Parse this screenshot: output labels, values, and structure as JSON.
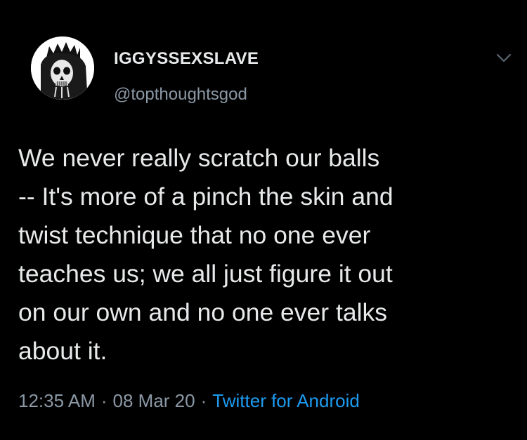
{
  "tweet": {
    "display_name": "IGGYSSEXSLAVE",
    "handle": "@topthoughtsgod",
    "text_lines": [
      "We never really scratch our balls",
      "-- It's more of a pinch the skin and",
      "twist technique that no one ever",
      "teaches us; we all just figure it out",
      "on our own and no one ever talks",
      "about it."
    ],
    "time": "12:35 AM",
    "separator": "·",
    "date": "08 Mar 20",
    "source": "Twitter for Android"
  },
  "icons": {
    "avatar": "skull-king-avatar",
    "menu": "chevron-down-icon"
  },
  "colors": {
    "background": "#000000",
    "primary_text": "#e7e9ea",
    "secondary_text": "#8b98a5",
    "link": "#1d9bf0"
  }
}
